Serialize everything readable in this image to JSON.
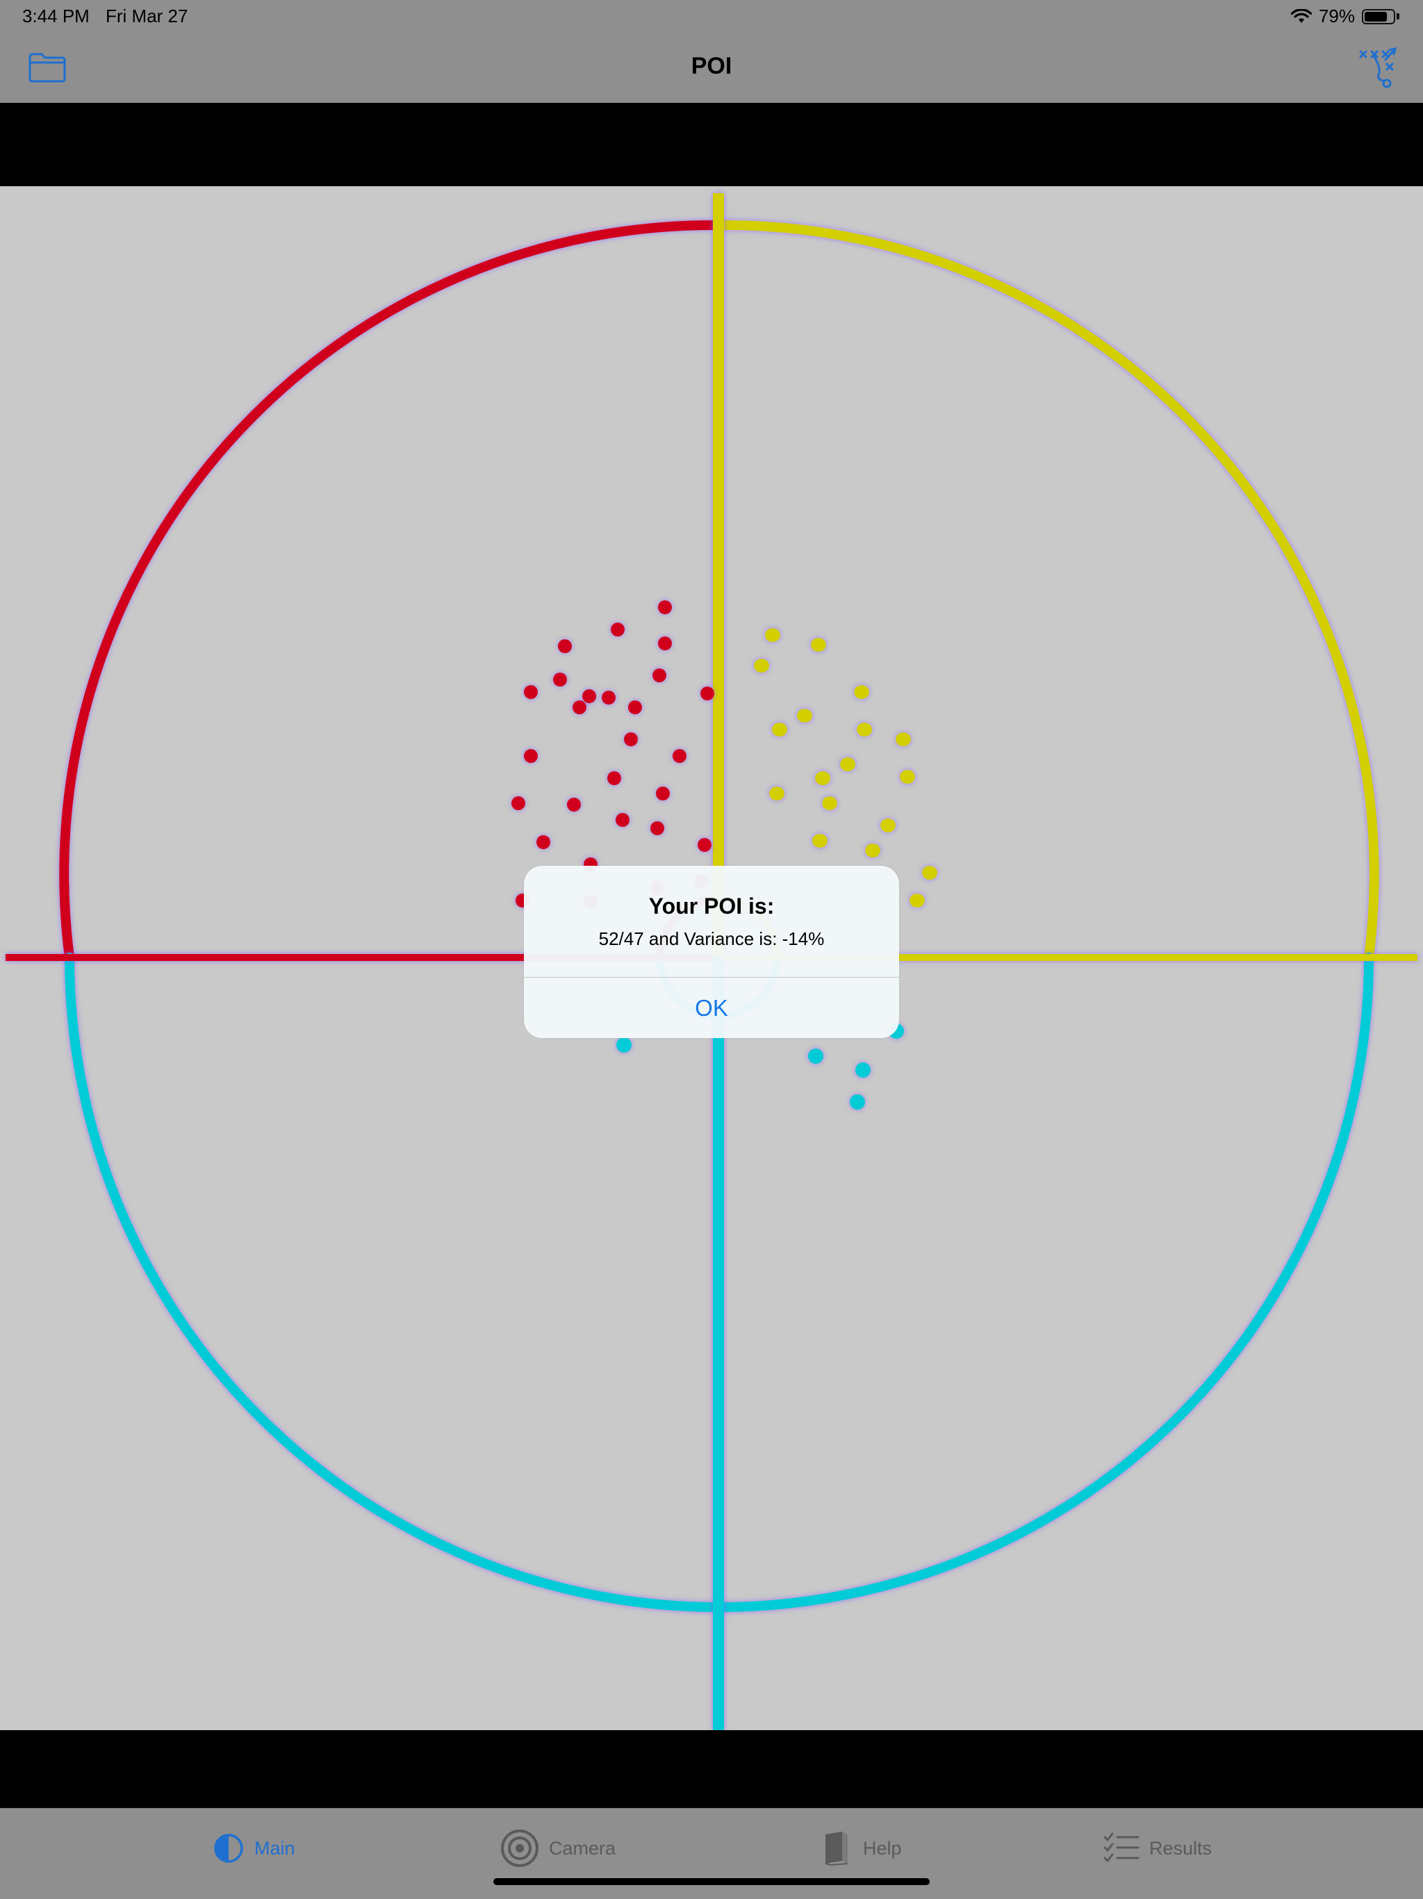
{
  "status_bar": {
    "time": "3:44 PM",
    "date": "Fri Mar 27",
    "battery_text": "79%",
    "battery_level": 0.79
  },
  "nav": {
    "title": "POI",
    "left_icon": "folder-icon",
    "right_icon": "play-diagram-icon",
    "accent_color": "#1e6fd0"
  },
  "target": {
    "colors": {
      "top_left": "#d0001a",
      "top_right": "#d4cf00",
      "bottom": "#00cbd6",
      "background": "#c9c9c9"
    }
  },
  "alert": {
    "title": "Your POI is:",
    "message": "52/47 and Variance is: -14%",
    "ok_label": "OK"
  },
  "tab_bar": {
    "items": [
      {
        "label": "Main",
        "icon": "half-circle-icon",
        "active": true
      },
      {
        "label": "Camera",
        "icon": "target-icon",
        "active": false
      },
      {
        "label": "Help",
        "icon": "book-icon",
        "active": false
      },
      {
        "label": "Results",
        "icon": "checklist-icon",
        "active": false
      }
    ]
  }
}
